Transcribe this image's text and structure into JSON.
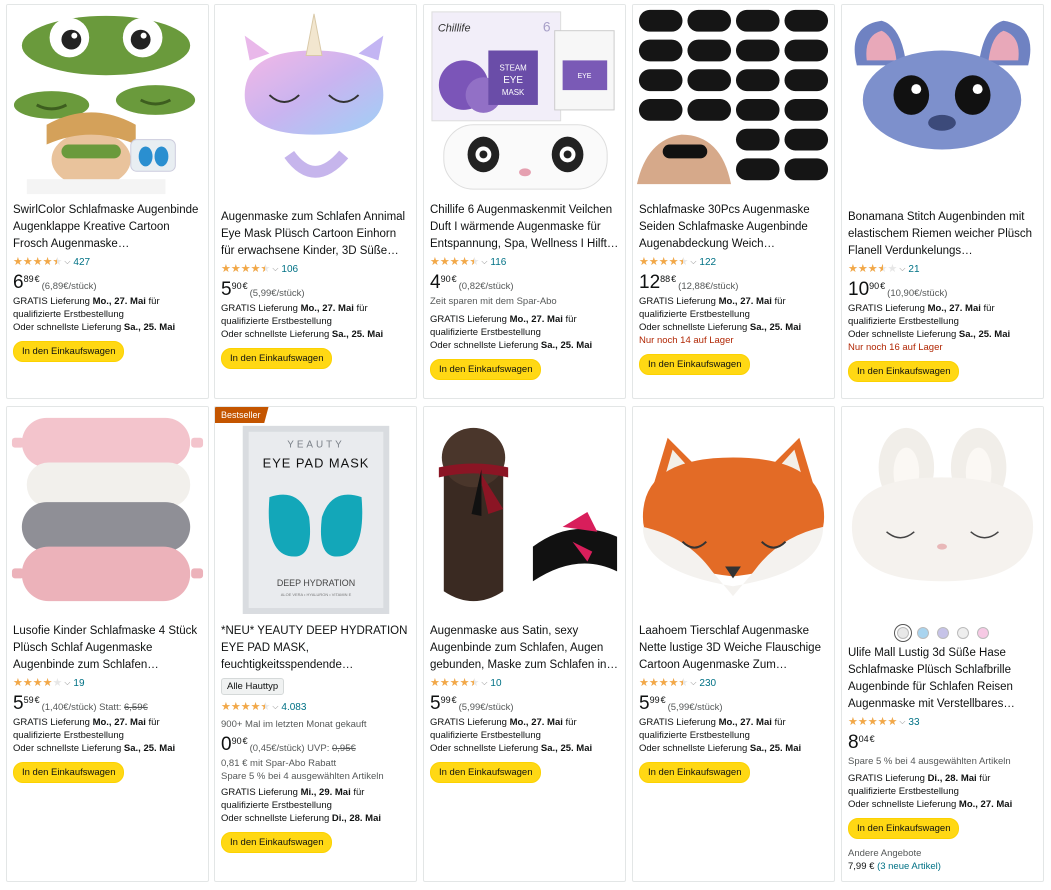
{
  "products": [
    {
      "title": "SwirlColor Schlafmaske Augenbinde Augenklappe Kreative Cartoon Frosch Augenmaske…",
      "rating": 4.5,
      "rating_icon": "star-rating",
      "reviews": "427",
      "price_whole": "6",
      "price_frac": "89",
      "currency": "€",
      "unit_price": "(6,89€/stück)",
      "delivery_prefix": "GRATIS Lieferung ",
      "delivery_date": "Mo., 27. Mai",
      "delivery_suffix": " für qualifizierte Erstbestellung",
      "fast_prefix": "Oder schnellste Lieferung ",
      "fast_date": "Sa., 25. Mai",
      "cart": "In den Einkaufswagen"
    },
    {
      "title": "Augenmaske zum Schlafen Annimal Eye Mask Plüsch Cartoon Einhorn für erwachsene Kinder, 3D Süße…",
      "rating": 4.5,
      "reviews": "106",
      "price_whole": "5",
      "price_frac": "90",
      "currency": "€",
      "unit_price": "(5,99€/stück)",
      "delivery_prefix": "GRATIS Lieferung ",
      "delivery_date": "Mo., 27. Mai",
      "delivery_suffix": " für qualifizierte Erstbestellung",
      "fast_prefix": "Oder schnellste Lieferung ",
      "fast_date": "Sa., 25. Mai",
      "cart": "In den Einkaufswagen"
    },
    {
      "title": "Chillife 6 Augenmaskenmit Veilchen Duft I wärmende Augenmaske für Entspannung, Spa, Wellness I Hilft…",
      "rating": 4.5,
      "reviews": "116",
      "price_whole": "4",
      "price_frac": "90",
      "currency": "€",
      "unit_price": "(0,82€/stück)",
      "note": "Zeit sparen mit dem Spar-Abo",
      "delivery_prefix": "GRATIS Lieferung ",
      "delivery_date": "Mo., 27. Mai",
      "delivery_suffix": " für qualifizierte Erstbestellung",
      "fast_prefix": "Oder schnellste Lieferung ",
      "fast_date": "Sa., 25. Mai",
      "cart": "In den Einkaufswagen"
    },
    {
      "title": "Schlafmaske 30Pcs Augenmaske Seiden Schlafmaske Augenbinde Augenabdeckung Weich…",
      "rating": 4.5,
      "reviews": "122",
      "price_whole": "12",
      "price_frac": "88",
      "currency": "€",
      "unit_price": "(12,88€/stück)",
      "delivery_prefix": "GRATIS Lieferung ",
      "delivery_date": "Mo., 27. Mai",
      "delivery_suffix": " für qualifizierte Erstbestellung",
      "fast_prefix": "Oder schnellste Lieferung ",
      "fast_date": "Sa., 25. Mai",
      "stock": "Nur noch 14 auf Lager",
      "cart": "In den Einkaufswagen"
    },
    {
      "title": "Bonamana Stitch Augenbinden mit elastischem Riemen weicher Plüsch Flanell Verdunkelungs Augenmaske…",
      "rating": 3.5,
      "reviews": "21",
      "price_whole": "10",
      "price_frac": "90",
      "currency": "€",
      "unit_price": "(10,90€/stück)",
      "delivery_prefix": "GRATIS Lieferung ",
      "delivery_date": "Mo., 27. Mai",
      "delivery_suffix": " für qualifizierte Erstbestellung",
      "fast_prefix": "Oder schnellste Lieferung ",
      "fast_date": "Sa., 25. Mai",
      "stock": "Nur noch 16 auf Lager",
      "cart": "In den Einkaufswagen"
    },
    {
      "title": "Lusofie Kinder Schlafmaske 4 Stück Plüsch Schlaf Augenmaske Augenbinde zum Schlafen Niedlich…",
      "rating": 4.0,
      "reviews": "19",
      "price_whole": "5",
      "price_frac": "59",
      "currency": "€",
      "unit_price": "(1,40€/stück)",
      "statt_label": " Statt: ",
      "old_price": "6,59€",
      "delivery_prefix": "GRATIS Lieferung ",
      "delivery_date": "Mo., 27. Mai",
      "delivery_suffix": " für qualifizierte Erstbestellung",
      "fast_prefix": "Oder schnellste Lieferung ",
      "fast_date": "Sa., 25. Mai",
      "cart": "In den Einkaufswagen"
    },
    {
      "badge": "Bestseller",
      "title": "*NEU* YEAUTY DEEP HYDRATION EYE PAD MASK, feuchtigkeitsspendende Augenpads…",
      "chip": "Alle Hauttyp",
      "rating": 4.5,
      "reviews": "4.083",
      "bought": "900+ Mal im letzten Monat gekauft",
      "price_whole": "0",
      "price_frac": "90",
      "currency": "€",
      "unit_price": "(0,45€/stück)",
      "statt_label": " UVP: ",
      "old_price": "0,95€",
      "sub_save": "0,81 € mit Spar-Abo Rabatt",
      "save5": "Spare 5 % bei 4 ausgewählten Artikeln",
      "delivery_prefix": "GRATIS Lieferung ",
      "delivery_date": "Mi., 29. Mai",
      "delivery_suffix": " für qualifizierte Erstbestellung",
      "fast_prefix": "Oder schnellste Lieferung ",
      "fast_date": "Di., 28. Mai",
      "cart": "In den Einkaufswagen",
      "image_text": {
        "brand": "YEAUTY",
        "name": "EYE PAD MASK",
        "sub": "DEEP HYDRATION",
        "tiny": "ALOE VERA • HYALURON • VITAMIN E"
      }
    },
    {
      "title": "Augenmaske aus Satin, sexy Augenbinde zum Schlafen, Augen gebunden, Maske zum Schlafen in…",
      "rating": 4.5,
      "reviews": "10",
      "price_whole": "5",
      "price_frac": "99",
      "currency": "€",
      "unit_price": "(5,99€/stück)",
      "delivery_prefix": "GRATIS Lieferung ",
      "delivery_date": "Mo., 27. Mai",
      "delivery_suffix": " für qualifizierte Erstbestellung",
      "fast_prefix": "Oder schnellste Lieferung ",
      "fast_date": "Sa., 25. Mai",
      "cart": "In den Einkaufswagen"
    },
    {
      "title": "Laahoem Tierschlaf Augenmaske Nette lustige 3D Weiche Flauschige Cartoon Augenmaske Zum Schlafen…",
      "rating": 4.5,
      "reviews": "230",
      "price_whole": "5",
      "price_frac": "99",
      "currency": "€",
      "unit_price": "(5,99€/stück)",
      "delivery_prefix": "GRATIS Lieferung ",
      "delivery_date": "Mo., 27. Mai",
      "delivery_suffix": " für qualifizierte Erstbestellung",
      "fast_prefix": "Oder schnellste Lieferung ",
      "fast_date": "Sa., 25. Mai",
      "cart": "In den Einkaufswagen"
    },
    {
      "swatch_colors": [
        "#e8e8e8",
        "#a9d4ef",
        "#c6c3e8",
        "#eeeeee",
        "#f6c9e4"
      ],
      "title": "Ulife Mall Lustig 3d Süße Hase Schlafmaske Plüsch Schlafbrille Augenbinde für Schlafen Reisen Augenmaske mit Verstellbares…",
      "rating": 5.0,
      "reviews": "33",
      "price_whole": "8",
      "price_frac": "04",
      "currency": "€",
      "save5": "Spare 5 % bei 4 ausgewählten Artikeln",
      "delivery_prefix": "GRATIS Lieferung ",
      "delivery_date": "Di., 28. Mai",
      "delivery_suffix": " für qualifizierte Erstbestellung",
      "fast_prefix": "Oder schnellste Lieferung ",
      "fast_date": "Mo., 27. Mai",
      "cart": "In den Einkaufswagen",
      "other_label": "Andere Angebote",
      "other_price": "7,99 € ",
      "other_link": "(3 neue Artikel)"
    }
  ],
  "image_labels": {
    "chillife_brand": "Chillife",
    "chillife_count": "6",
    "steam": "STEAM",
    "eye": "EYE",
    "mask": "MASK"
  },
  "colors": {
    "star": "#f3a847",
    "button": "#ffd814",
    "link": "#007185",
    "badge": "#c45500",
    "stock_red": "#b12704"
  }
}
